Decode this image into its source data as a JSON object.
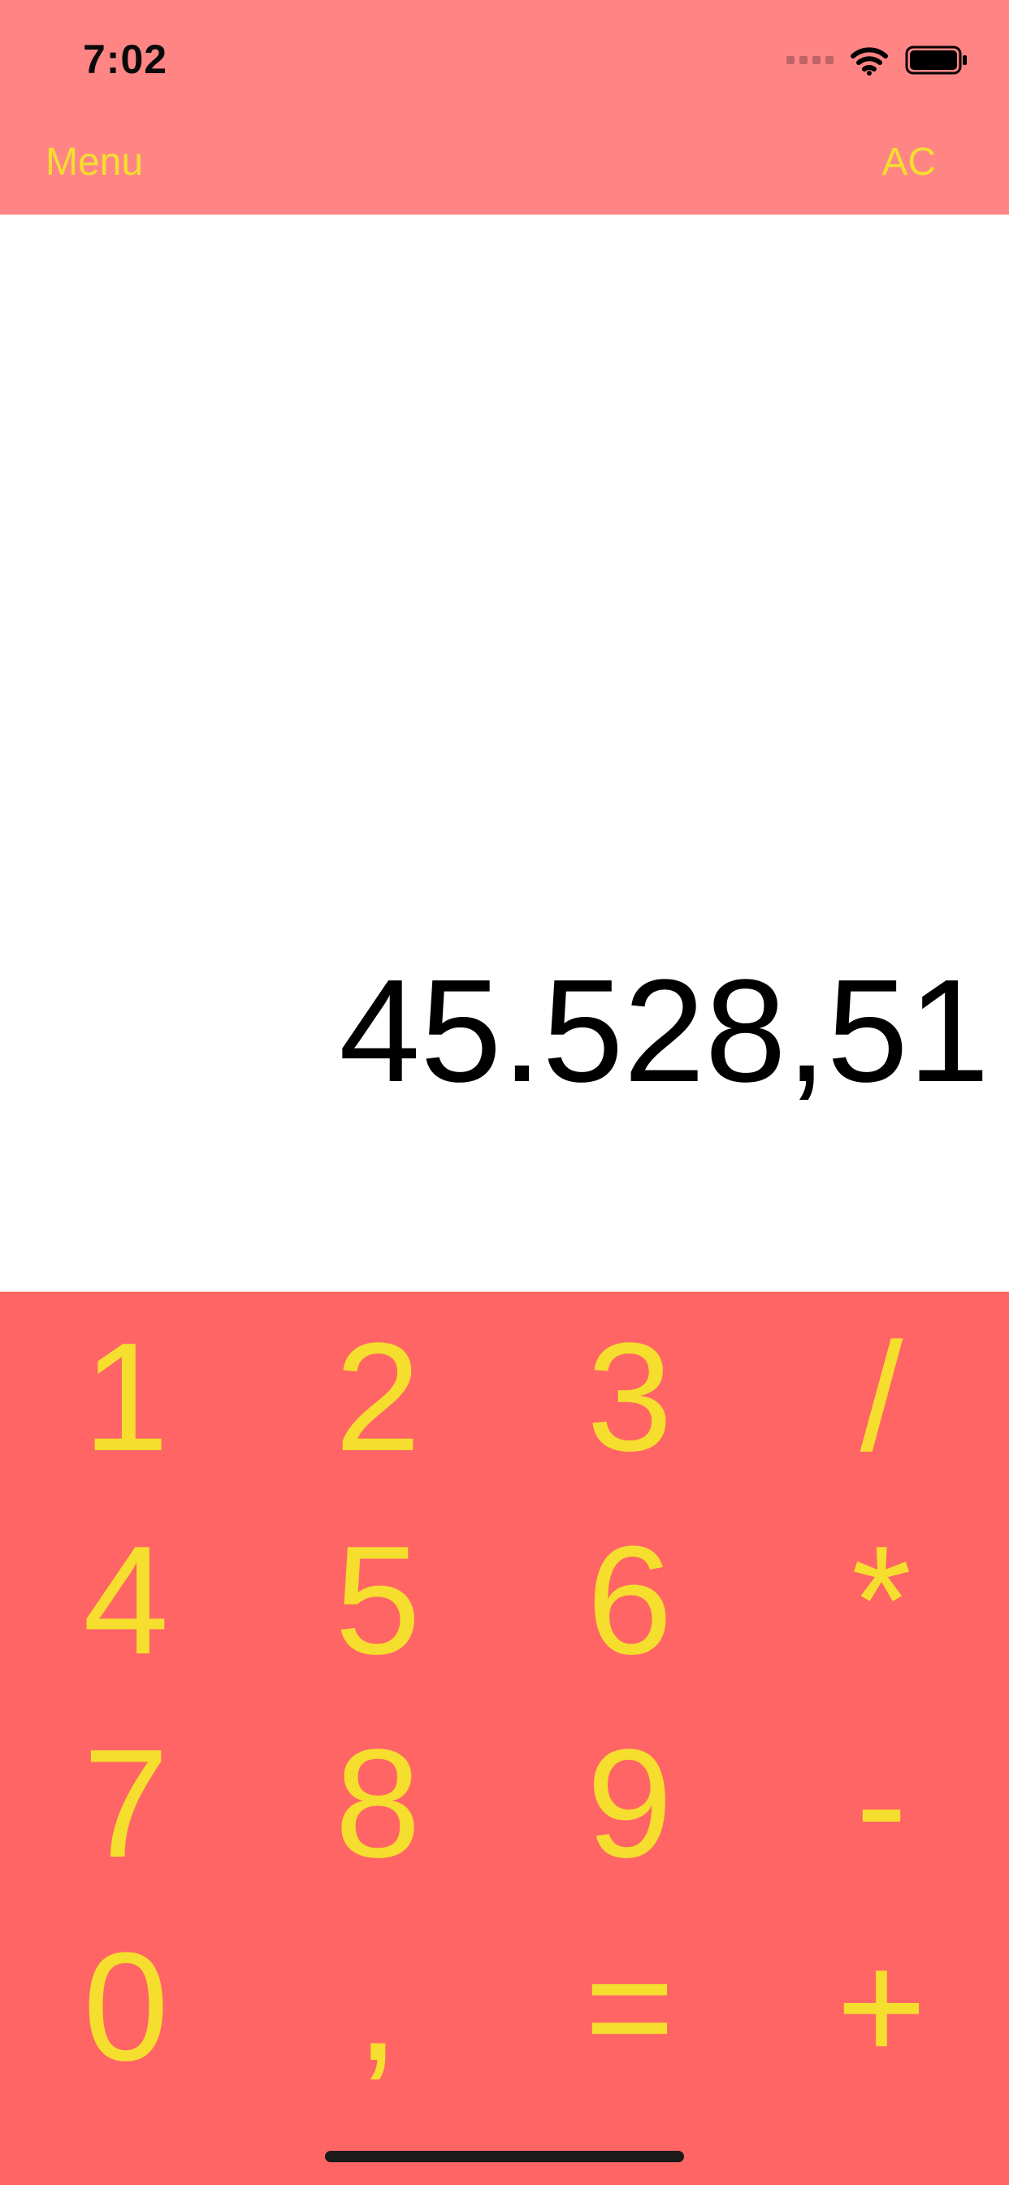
{
  "status_bar": {
    "time": "7:02"
  },
  "nav": {
    "left_label": "Menu",
    "right_label": "AC"
  },
  "display": {
    "value": "45.528,51"
  },
  "keypad": {
    "keys": [
      "1",
      "2",
      "3",
      "/",
      "4",
      "5",
      "6",
      "*",
      "7",
      "8",
      "9",
      "-",
      "0",
      ",",
      "=",
      "+"
    ]
  },
  "colors": {
    "header_background": "#ff8585",
    "keypad_background": "#ff6565",
    "accent_text": "#f5de2e",
    "display_text": "#000000"
  },
  "icons": [
    "signal-icon",
    "wifi-icon",
    "battery-icon"
  ]
}
